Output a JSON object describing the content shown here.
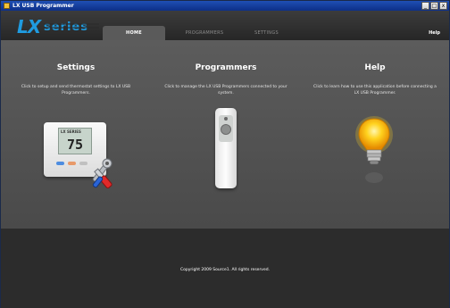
{
  "window": {
    "title": "LX USB Programmer",
    "controls": [
      "_",
      "□",
      "x"
    ]
  },
  "nav": {
    "logo": {
      "prefix": "LX",
      "suffix": "series"
    },
    "tabs": [
      {
        "label": "HOME",
        "active": true
      },
      {
        "label": "PROGRAMMERS",
        "active": false
      },
      {
        "label": "SETTINGS",
        "active": false
      }
    ],
    "help_label": "Help"
  },
  "cards": {
    "settings": {
      "title": "Settings",
      "description": "Click to setup and send thermostat settings to LX USB Programmers."
    },
    "programmers": {
      "title": "Programmers",
      "description": "Click to manage the LX USB Programmers connected to your system."
    },
    "help": {
      "title": "Help",
      "description": "Click to learn how to use this application before connecting a LX USB Programmer."
    }
  },
  "thermostat_display": {
    "brand": "LX SERIES",
    "temperature": "75"
  },
  "footer": {
    "copyright": "Copyright 2009 Source1. All rights reserved."
  },
  "colors": {
    "accent": "#1f9be0",
    "background": "#4a4a4a",
    "footer": "#2c2c2c",
    "titlebar": "#0d2f87"
  },
  "icons": [
    "app-icon",
    "wrench-screwdriver-icon",
    "thermostat-icon",
    "remote-programmer-icon",
    "light-bulb-icon"
  ]
}
